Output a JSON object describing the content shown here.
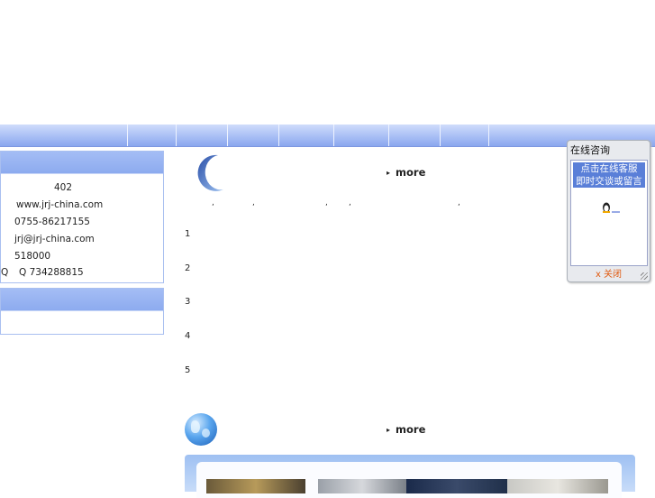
{
  "contact": {
    "line1": "402",
    "website": "www.jrj-china.com",
    "phone": "0755-86217155",
    "email": "jrj@jrj-china.com",
    "postcode": "518000",
    "qq_label": "Q",
    "qq": "Q 734288815"
  },
  "news": {
    "more_label": "more",
    "ticks": [
      ",",
      ",",
      ",",
      ",",
      ","
    ],
    "numbers": [
      "1",
      "2",
      "3",
      "4",
      "5"
    ]
  },
  "gallery": {
    "more_label": "more"
  },
  "consult": {
    "title": "在线咨询",
    "cta_line1": "点击在线客服",
    "cta_line2": "即时交谈或留言",
    "close_label": "关闭",
    "close_mark": "x"
  },
  "colors": {
    "nav": "#a9bff5",
    "accent": "#5a7fd8",
    "close": "#e05a10"
  }
}
